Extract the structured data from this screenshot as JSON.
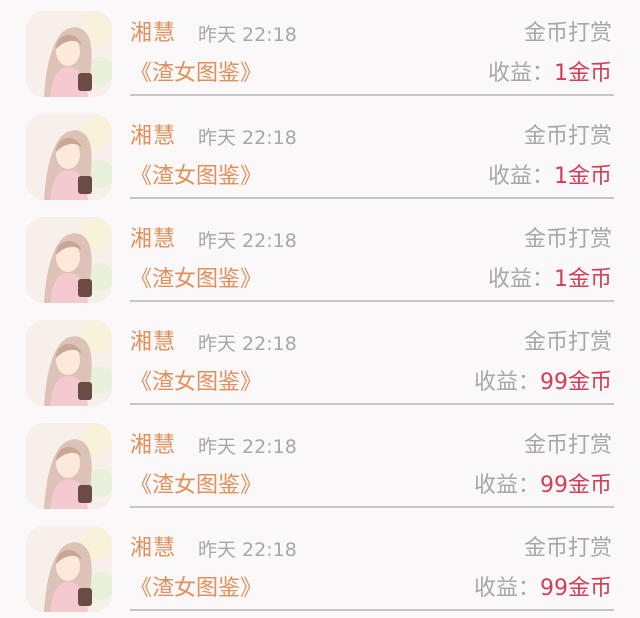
{
  "rows": [
    {
      "name": "湘慧",
      "time": "昨天 22:18",
      "reward_type": "金币打赏",
      "book": "《渣女图鉴》",
      "income_label": "收益：",
      "income_amount": "1金币"
    },
    {
      "name": "湘慧",
      "time": "昨天 22:18",
      "reward_type": "金币打赏",
      "book": "《渣女图鉴》",
      "income_label": "收益：",
      "income_amount": "1金币"
    },
    {
      "name": "湘慧",
      "time": "昨天 22:18",
      "reward_type": "金币打赏",
      "book": "《渣女图鉴》",
      "income_label": "收益：",
      "income_amount": "1金币"
    },
    {
      "name": "湘慧",
      "time": "昨天 22:18",
      "reward_type": "金币打赏",
      "book": "《渣女图鉴》",
      "income_label": "收益：",
      "income_amount": "99金币"
    },
    {
      "name": "湘慧",
      "time": "昨天 22:18",
      "reward_type": "金币打赏",
      "book": "《渣女图鉴》",
      "income_label": "收益：",
      "income_amount": "99金币"
    },
    {
      "name": "湘慧",
      "time": "昨天 22:18",
      "reward_type": "金币打赏",
      "book": "《渣女图鉴》",
      "income_label": "收益：",
      "income_amount": "99金币"
    }
  ],
  "colors": {
    "name": "#e0905b",
    "book": "#e0905b",
    "muted": "#a7a7a7",
    "amount": "#d33d55",
    "divider": "#c6c6c6",
    "background": "#fbf8fa"
  },
  "icons": {
    "avatar": "avatar-illustration"
  }
}
